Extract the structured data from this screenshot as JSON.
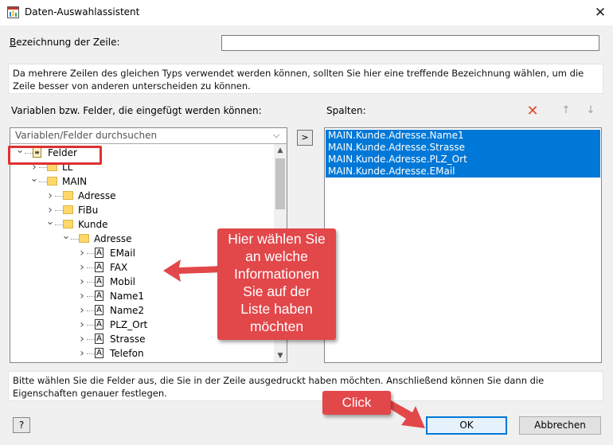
{
  "window": {
    "title": "Daten-Auswahlassistent",
    "close_glyph": "✕"
  },
  "name_row": {
    "label": "Bezeichnung der Zeile:",
    "value": ""
  },
  "info_top": "Da mehrere Zeilen des gleichen Typs verwendet werden können, sollten Sie hier eine treffende Bezeichnung wählen, um die Zeile besser von anderen unterscheiden zu können.",
  "variables": {
    "label": "Variablen bzw. Felder, die eingefügt werden können:",
    "search_placeholder": "Variablen/Felder durchsuchen",
    "tree": [
      {
        "label": "Felder",
        "type": "root",
        "expanded": true,
        "level": 0
      },
      {
        "label": "LL",
        "type": "folder",
        "expanded": false,
        "level": 1
      },
      {
        "label": "MAIN",
        "type": "folder",
        "expanded": true,
        "level": 1
      },
      {
        "label": "Adresse",
        "type": "folder",
        "expanded": false,
        "level": 2
      },
      {
        "label": "FiBu",
        "type": "folder",
        "expanded": false,
        "level": 2
      },
      {
        "label": "Kunde",
        "type": "folder",
        "expanded": true,
        "level": 2
      },
      {
        "label": "Adresse",
        "type": "folder",
        "expanded": true,
        "level": 3
      },
      {
        "label": "EMail",
        "type": "field",
        "level": 4
      },
      {
        "label": "FAX",
        "type": "field",
        "level": 4
      },
      {
        "label": "Mobil",
        "type": "field",
        "level": 4
      },
      {
        "label": "Name1",
        "type": "field",
        "level": 4
      },
      {
        "label": "Name2",
        "type": "field",
        "level": 4
      },
      {
        "label": "PLZ_Ort",
        "type": "field",
        "level": 4
      },
      {
        "label": "Strasse",
        "type": "field",
        "level": 4
      },
      {
        "label": "Telefon",
        "type": "field",
        "level": 4
      }
    ],
    "field_glyph": "A"
  },
  "add_button_label": ">",
  "columns": {
    "label": "Spalten:",
    "items": [
      "MAIN.Kunde.Adresse.Name1",
      "MAIN.Kunde.Adresse.Strasse",
      "MAIN.Kunde.Adresse.PLZ_Ort",
      "MAIN.Kunde.Adresse.EMail"
    ],
    "selection_color": "#0078d7",
    "delete_icon": "✕",
    "up_icon": "↑",
    "down_icon": "↓"
  },
  "info_bottom": "Bitte wählen Sie die Felder aus, die Sie in der Zeile ausgedruckt haben möchten. Anschließend können Sie dann die Eigenschaften genauer festlegen.",
  "buttons": {
    "help": "?",
    "ok": "OK",
    "cancel": "Abbrechen"
  },
  "callouts": {
    "main_lines": [
      "Hier wählen Sie",
      "an welche",
      "Informationen",
      "Sie auf der",
      "Liste haben",
      "möchten"
    ],
    "click": "Click",
    "color": "#e2474a"
  }
}
